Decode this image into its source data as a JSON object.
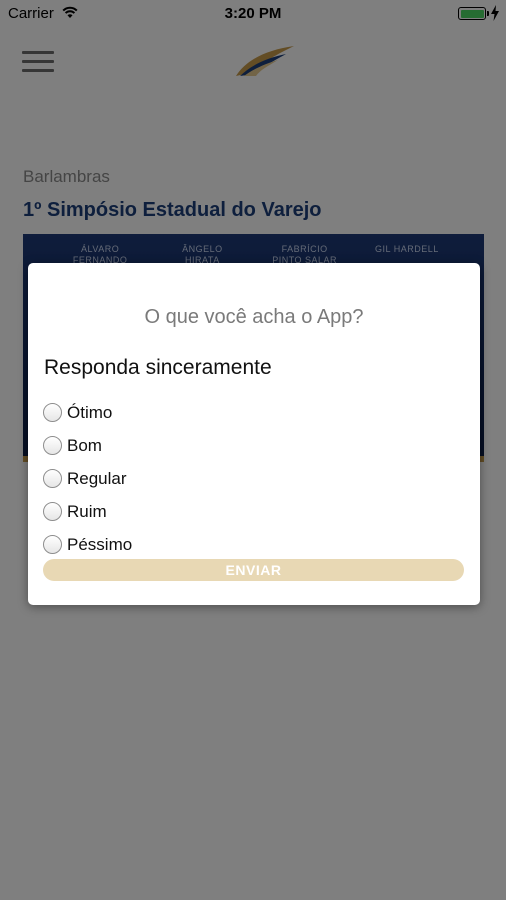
{
  "status_bar": {
    "carrier": "Carrier",
    "time": "3:20 PM"
  },
  "header": {
    "menu_icon": "hamburger-menu-icon",
    "logo_icon": "feather-wing-logo"
  },
  "content": {
    "subtitle": "Barlambras",
    "title": "1º Simpósio Estadual do Varejo",
    "banner_names": [
      "ÁLVARO FERNANDO",
      "ÂNGELO HIRATA",
      "FABRÍCIO PINTO SALAR",
      "GIL HARDELL"
    ]
  },
  "modal": {
    "question": "O que você acha o App?",
    "heading": "Responda sinceramente",
    "options": [
      "Ótimo",
      "Bom",
      "Regular",
      "Ruim",
      "Péssimo"
    ],
    "submit_label": "ENVIAR"
  },
  "colors": {
    "title_blue": "#1d3f7a",
    "button_tan": "#e8d8b4",
    "banner_navy": "#0f2556",
    "battery_green": "#4cd964"
  }
}
